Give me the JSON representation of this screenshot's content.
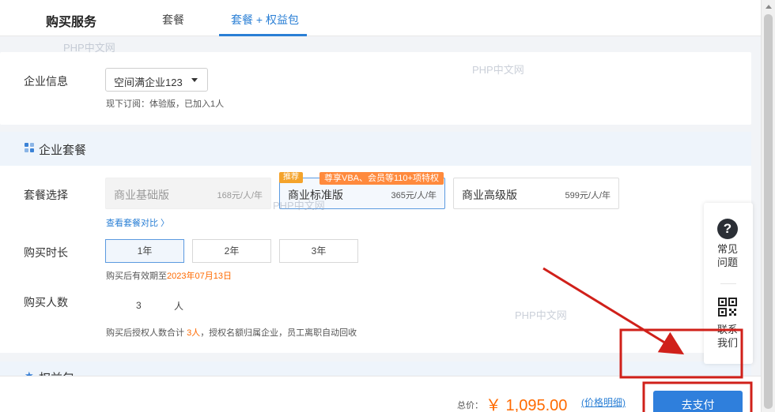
{
  "header": {
    "title": "购买服务",
    "tabs": [
      {
        "label": "套餐"
      },
      {
        "label": "套餐 + 权益包"
      }
    ]
  },
  "company": {
    "label": "企业信息",
    "selected": "空间满企业123",
    "subscription_note": "现下订阅：体验版，已加入1人"
  },
  "package_section": {
    "title": "企业套餐",
    "plan_label": "套餐选择",
    "plans": [
      {
        "name": "商业基础版",
        "price": "168元/人/年"
      },
      {
        "name": "商业标准版",
        "price": "365元/人/年"
      },
      {
        "name": "商业高级版",
        "price": "599元/人/年"
      }
    ],
    "recommend_badge": "推荐",
    "promo_badge": "尊享VBA、会员等110+项特权",
    "compare_link": "查看套餐对比 〉",
    "duration_label": "购买时长",
    "durations": [
      "1年",
      "2年",
      "3年"
    ],
    "expire_prefix": "购买后有效期至",
    "expire_date": "2023年07月13日",
    "quantity_label": "购买人数",
    "quantity_value": "3",
    "quantity_unit": "人",
    "quantity_hint_prefix": "购买后授权人数合计",
    "quantity_hint_count": "3人",
    "quantity_hint_suffix": "，授权名额归属企业，员工离职自动回收"
  },
  "benefit_section": {
    "title": "权益包"
  },
  "footer": {
    "total_label": "总价：",
    "total_value": "￥ 1,095.00",
    "price_detail_link": "(价格明细)",
    "pay_button": "去支付"
  },
  "float_panel": {
    "help_label": "常见问题",
    "contact_label": "联系我们"
  },
  "watermark_text": "PHP中文网",
  "colors": {
    "accent": "#2a7fd5",
    "price": "#ff6a00",
    "annotation": "#d0201a"
  }
}
